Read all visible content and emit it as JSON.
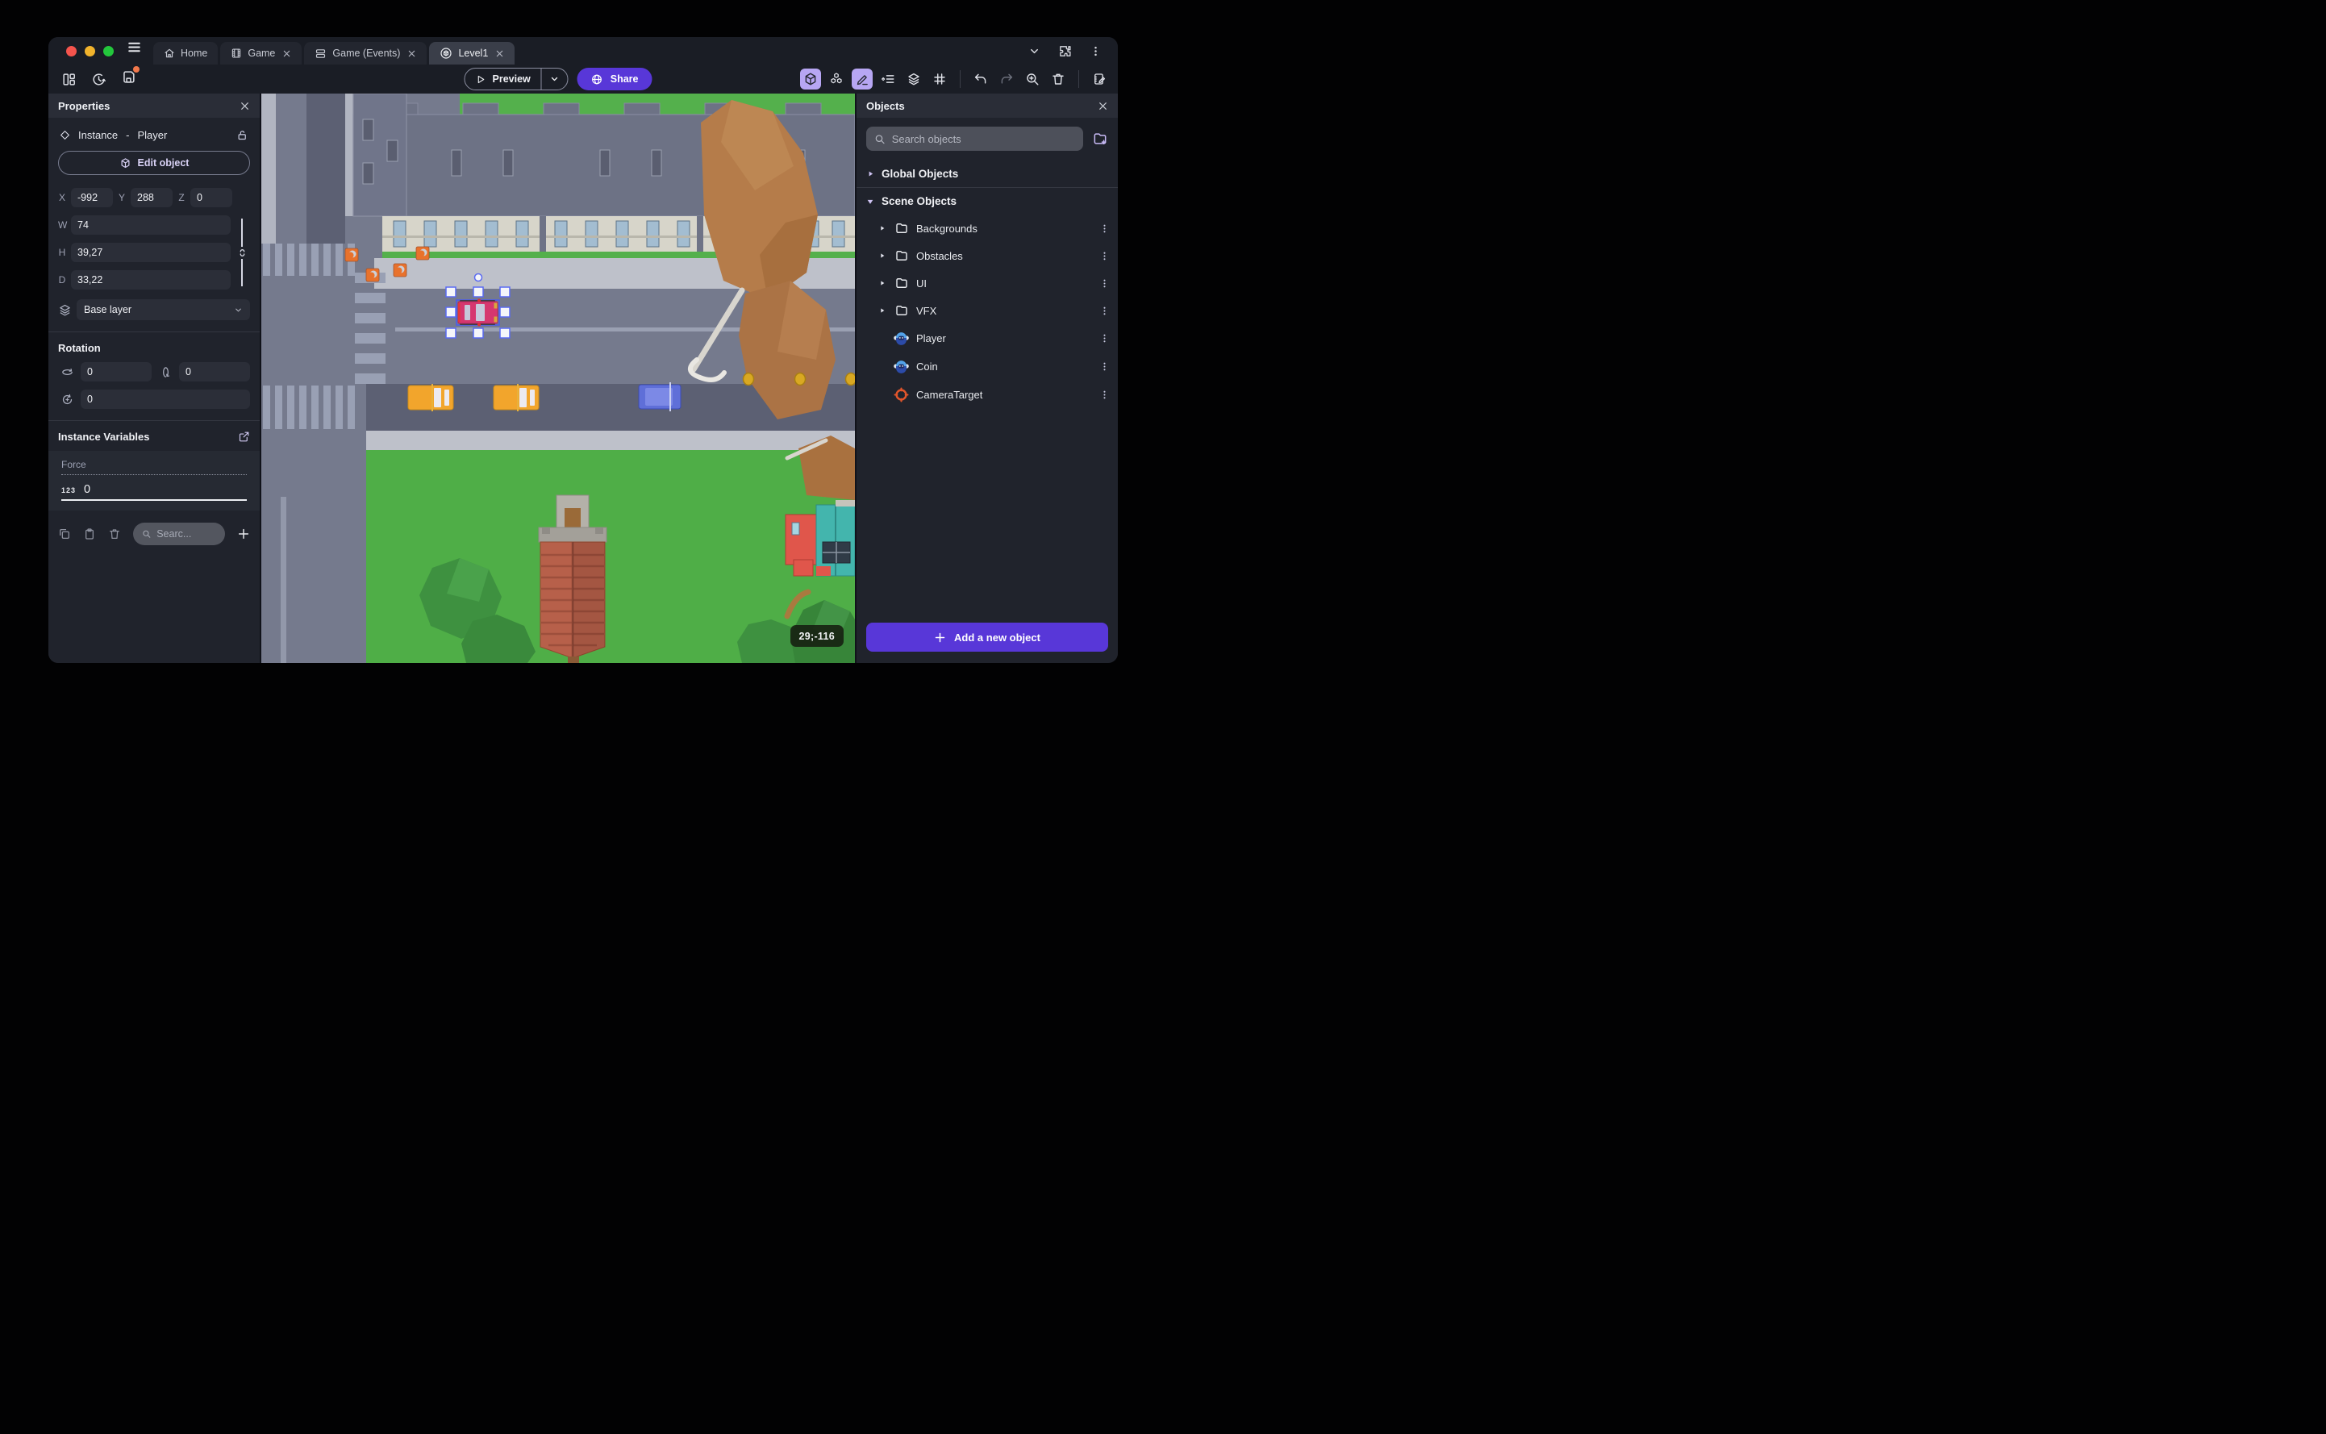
{
  "window": {
    "tabs": [
      {
        "label": "Home",
        "closable": false,
        "active": false
      },
      {
        "label": "Game",
        "closable": true,
        "active": false
      },
      {
        "label": "Game (Events)",
        "closable": true,
        "active": false
      },
      {
        "label": "Level1",
        "closable": true,
        "active": true
      }
    ],
    "toolbar": {
      "preview_label": "Preview",
      "share_label": "Share"
    }
  },
  "properties_panel": {
    "title": "Properties",
    "instance_label": "Instance",
    "separator": "-",
    "instance_name": "Player",
    "edit_object_label": "Edit object",
    "x_label": "X",
    "x_value": "-992",
    "y_label": "Y",
    "y_value": "288",
    "z_label": "Z",
    "z_value": "0",
    "w_label": "W",
    "w_value": "74",
    "h_label": "H",
    "h_value": "39,27",
    "d_label": "D",
    "d_value": "33,22",
    "layer_value": "Base layer",
    "rotation_title": "Rotation",
    "rotation_x": "0",
    "rotation_y": "0",
    "rotation_z": "0",
    "variables_title": "Instance Variables",
    "variable_name": "Force",
    "variable_type_badge": "123",
    "variable_value": "0",
    "search_placeholder": "Searc..."
  },
  "objects_panel": {
    "title": "Objects",
    "search_placeholder": "Search objects",
    "global_group": "Global Objects",
    "scene_group": "Scene Objects",
    "folders": [
      "Backgrounds",
      "Obstacles",
      "UI",
      "VFX"
    ],
    "objects": [
      {
        "name": "Player",
        "icon": "monkey-sprite"
      },
      {
        "name": "Coin",
        "icon": "monkey-sprite"
      },
      {
        "name": "CameraTarget",
        "icon": "camera-target"
      }
    ],
    "add_button_label": "Add a new object"
  },
  "canvas": {
    "coordinate_badge": "29;-116"
  },
  "colors": {
    "accent_purple": "#5837d8",
    "toolbar_highlight": "#b7a6f3",
    "selection_blue": "#4a5bf0",
    "notification_orange": "#f2784b",
    "traffic_red": "#f5544d",
    "traffic_yellow": "#f1b32c",
    "traffic_green": "#23c73c"
  }
}
